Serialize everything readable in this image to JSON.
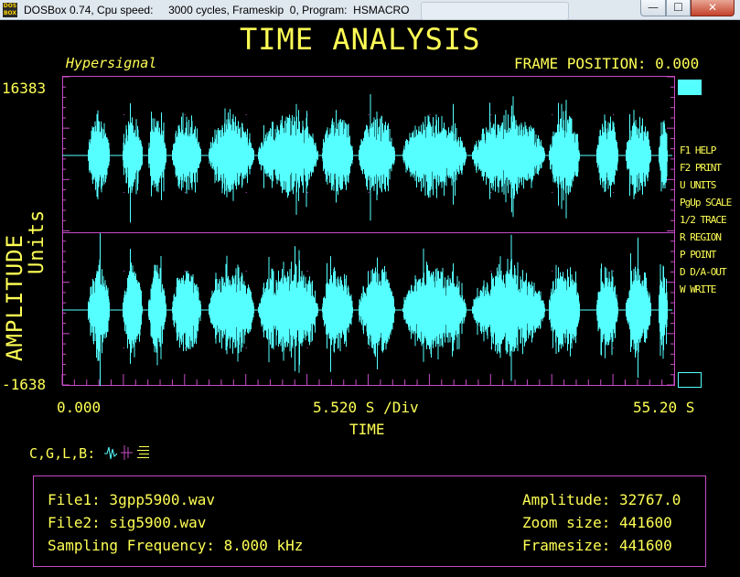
{
  "window": {
    "title": "DOSBox 0.74, Cpu speed:     3000 cycles, Frameskip  0, Program:  HSMACRO",
    "icon_label": "DOS BOX",
    "background_tab_hint": "",
    "controls": {
      "minimize": "—",
      "maximize": "☐",
      "close": "✕"
    }
  },
  "screen": {
    "title": "TIME ANALYSIS",
    "program": "Hypersignal",
    "frame_position": "FRAME POSITION: 0.000"
  },
  "axes": {
    "y_max": "16383",
    "y_min": "-1638",
    "y_label": "AMPLITUDE",
    "y_units": "Units",
    "x_start": "0.000",
    "x_division": "5.520 S /Div",
    "x_end": "55.20 S",
    "x_label": "TIME"
  },
  "menu": [
    "F1 HELP",
    "F2 PRINT",
    "U UNITS",
    "PgUp SCALE",
    "1/2 TRACE",
    "R REGION",
    "P POINT",
    "D D/A-OUT",
    "W WRITE"
  ],
  "cursor_modes": "C,G,L,B:",
  "cursor_icons": [
    "waveform-icon",
    "cross-cursor-icon",
    "bars-icon"
  ],
  "info": {
    "file1": "File1: 3gpp5900.wav",
    "file2": "File2: sig5900.wav",
    "sampling": "Sampling Frequency: 8.000 kHz",
    "amplitude": "Amplitude: 32767.0",
    "zoom": "Zoom size: 441600",
    "framesize": "Framesize: 441600"
  },
  "colors": {
    "background": "#000000",
    "text": "#ffff55",
    "waveform": "#55ffff",
    "border": "#c64bc6"
  }
}
